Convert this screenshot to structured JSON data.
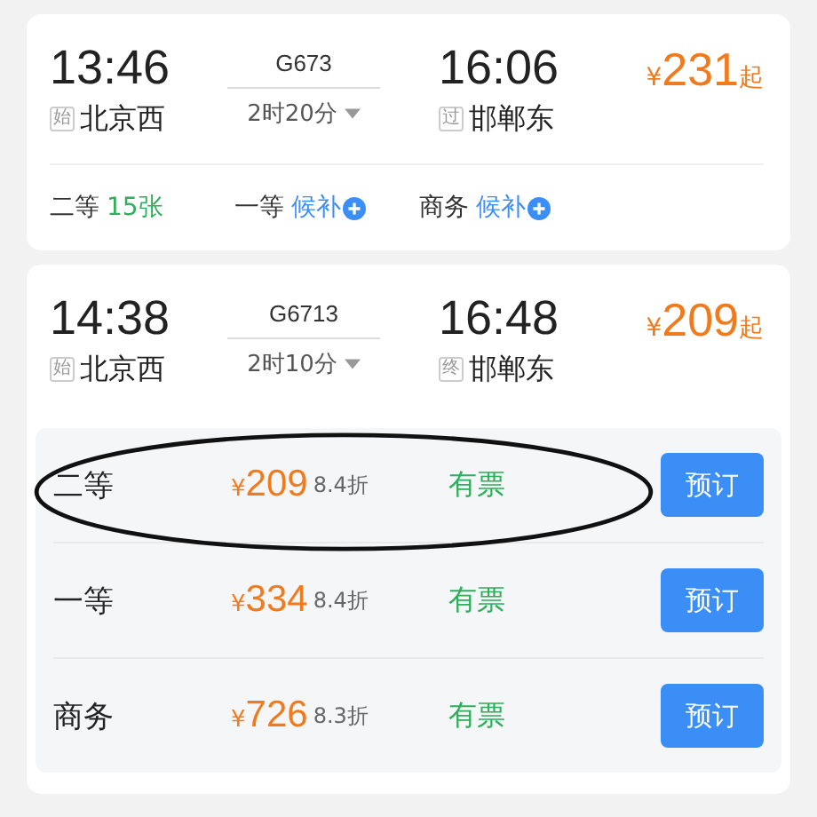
{
  "trains": [
    {
      "depart_time": "13:46",
      "depart_station": "北京西",
      "depart_tag": "始",
      "train_no": "G673",
      "duration": "2时20分",
      "expanded": false,
      "arrive_time": "16:06",
      "arrive_station": "邯郸东",
      "arrive_tag": "过",
      "price": {
        "currency": "¥",
        "amount": "231",
        "suffix": "起"
      },
      "seats": [
        {
          "kind": "count",
          "class": "二等",
          "availability": "15张"
        },
        {
          "kind": "waitlist",
          "class": "一等",
          "availability": "候补"
        },
        {
          "kind": "waitlist",
          "class": "商务",
          "availability": "候补"
        }
      ]
    },
    {
      "depart_time": "14:38",
      "depart_station": "北京西",
      "depart_tag": "始",
      "train_no": "G6713",
      "duration": "2时10分",
      "expanded": true,
      "arrive_time": "16:48",
      "arrive_station": "邯郸东",
      "arrive_tag": "终",
      "price": {
        "currency": "¥",
        "amount": "209",
        "suffix": "起"
      },
      "fares": [
        {
          "class": "二等",
          "currency": "¥",
          "amount": "209",
          "discount": "8.4折",
          "status": "有票",
          "button": "预订",
          "circled": true
        },
        {
          "class": "一等",
          "currency": "¥",
          "amount": "334",
          "discount": "8.4折",
          "status": "有票",
          "button": "预订",
          "circled": false
        },
        {
          "class": "商务",
          "currency": "¥",
          "amount": "726",
          "discount": "8.3折",
          "status": "有票",
          "button": "预订",
          "circled": false
        }
      ]
    }
  ]
}
